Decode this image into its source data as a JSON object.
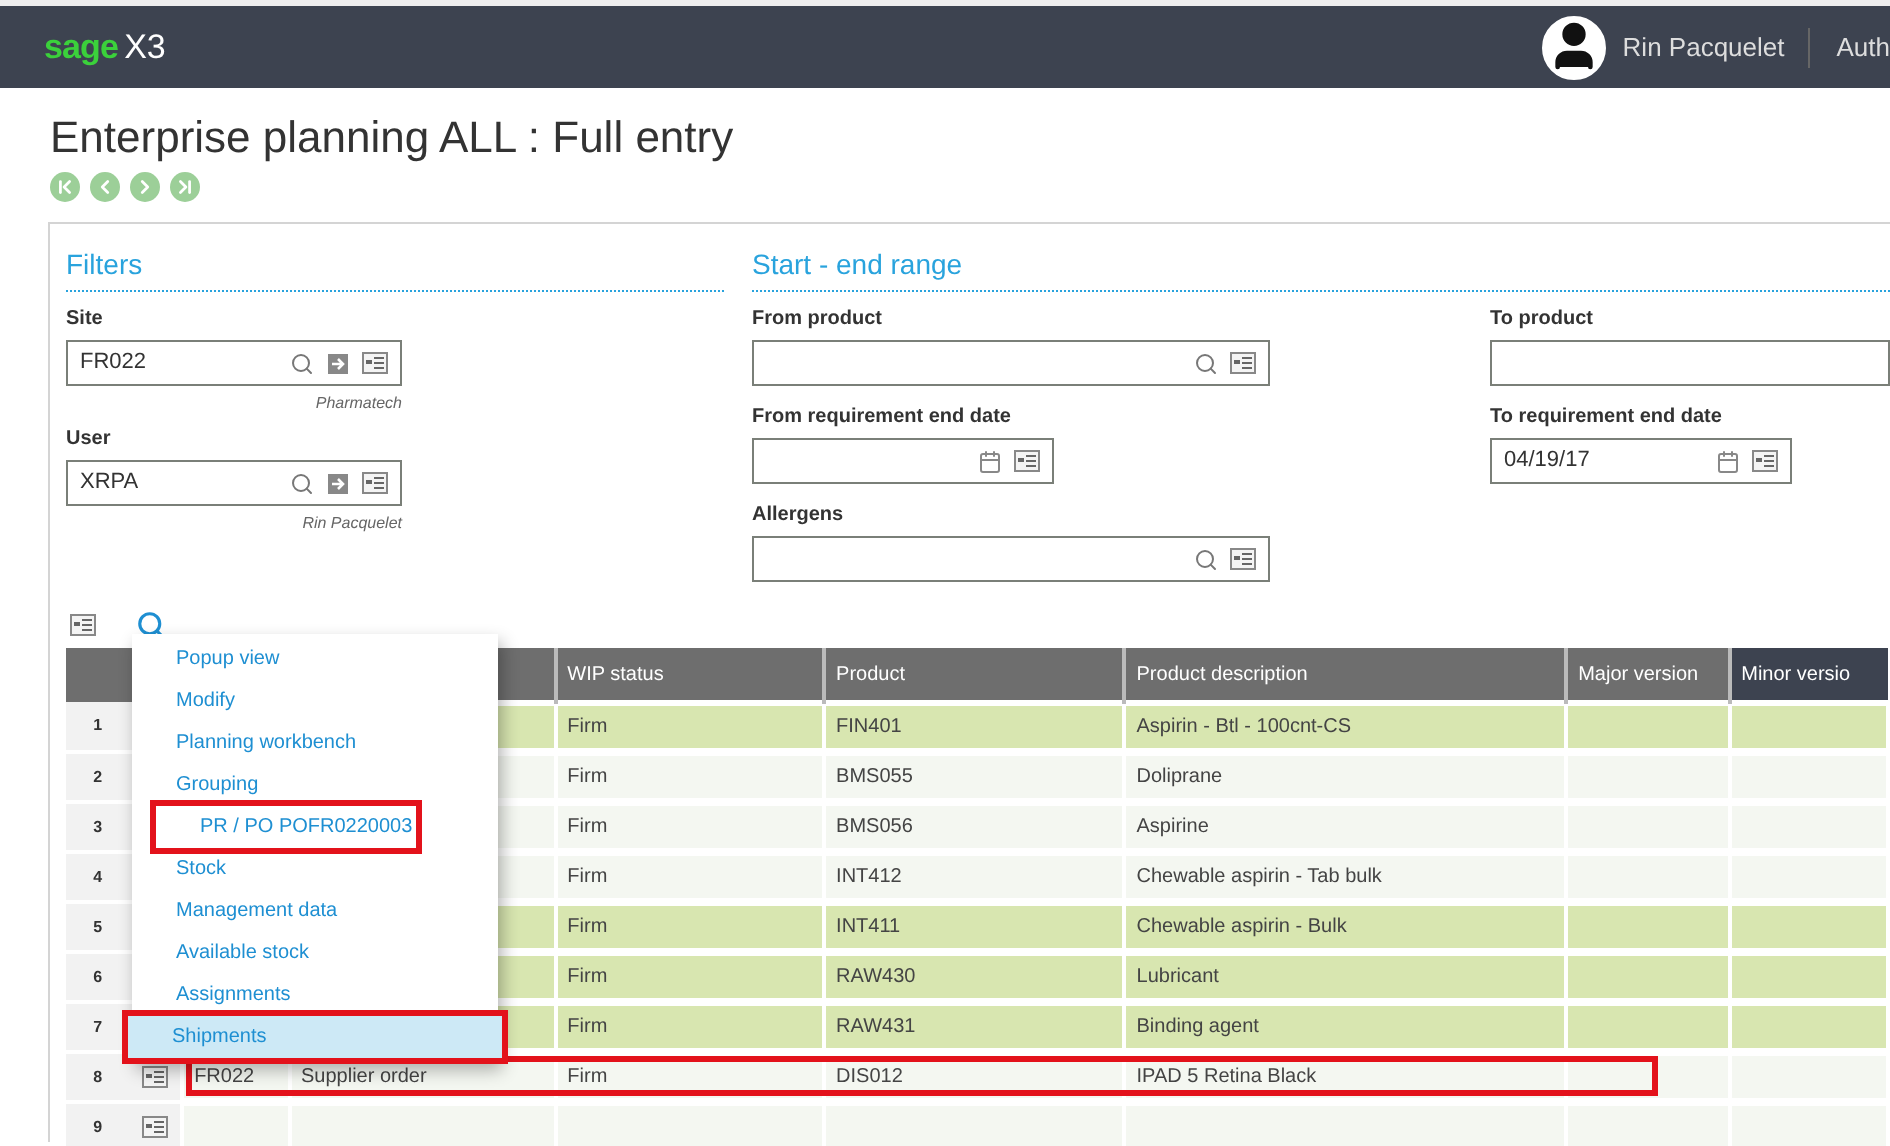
{
  "header": {
    "logo_brand": "sage",
    "logo_product": "X3",
    "user": "Rin Pacquelet",
    "next_item": "Auth"
  },
  "title": "Enterprise planning ALL : Full entry",
  "filters": {
    "title": "Filters",
    "fields": [
      {
        "label": "Site",
        "value": "FR022",
        "caption": "Pharmatech"
      },
      {
        "label": "User",
        "value": "XRPA",
        "caption": "Rin Pacquelet"
      }
    ]
  },
  "range": {
    "title": "Start - end range",
    "fields": [
      {
        "label": "From product",
        "kind": "lookup"
      },
      {
        "label": "To product",
        "kind": "cut"
      },
      {
        "label": "From requirement end date",
        "kind": "date"
      },
      {
        "label": "To requirement end date",
        "value": "04/19/17",
        "kind": "date"
      },
      {
        "label": "Allergens",
        "kind": "lookup"
      }
    ]
  },
  "grid": {
    "columns": [
      "WIP status",
      "Product",
      "Product description",
      "Major version",
      "Minor versio"
    ],
    "rows": [
      {
        "number": "1",
        "highlighted": true,
        "annotated": false,
        "wip": "Firm",
        "product": "FIN401",
        "description": "Aspirin - Btl - 100cnt-CS"
      },
      {
        "number": "2",
        "highlighted": false,
        "annotated": false,
        "wip": "Firm",
        "product": "BMS055",
        "description": "Doliprane"
      },
      {
        "number": "3",
        "highlighted": false,
        "annotated": false,
        "wip": "Firm",
        "product": "BMS056",
        "description": "Aspirine"
      },
      {
        "number": "4",
        "highlighted": false,
        "annotated": false,
        "wip": "Firm",
        "product": "INT412",
        "description": "Chewable aspirin - Tab bulk"
      },
      {
        "number": "5",
        "highlighted": true,
        "annotated": false,
        "wip": "Firm",
        "product": "INT411",
        "description": "Chewable aspirin - Bulk"
      },
      {
        "number": "6",
        "highlighted": true,
        "annotated": false,
        "wip": "Firm",
        "product": "RAW430",
        "description": "Lubricant"
      },
      {
        "number": "7",
        "highlighted": true,
        "annotated": false,
        "wip": "Firm",
        "product": "RAW431",
        "description": "Binding agent"
      },
      {
        "number": "8",
        "highlighted": false,
        "annotated": true,
        "site": "FR022",
        "type": "Supplier order",
        "wip": "Firm",
        "product": "DIS012",
        "description": "IPAD 5 Retina Black"
      },
      {
        "number": "9",
        "highlighted": false,
        "annotated": false
      }
    ]
  },
  "menu": {
    "items": [
      {
        "label": "Popup view",
        "selected": false,
        "annotated": false
      },
      {
        "label": "Modify",
        "selected": false,
        "annotated": false
      },
      {
        "label": "Planning workbench",
        "selected": false,
        "annotated": false
      },
      {
        "label": "Grouping",
        "selected": false,
        "annotated": false
      },
      {
        "label": "PR / PO POFR0220003",
        "selected": false,
        "annotated": true
      },
      {
        "label": "Stock",
        "selected": false,
        "annotated": false
      },
      {
        "label": "Management data",
        "selected": false,
        "annotated": false
      },
      {
        "label": "Available stock",
        "selected": false,
        "annotated": false
      },
      {
        "label": "Assignments",
        "selected": false,
        "annotated": false
      },
      {
        "label": "Shipments",
        "selected": true,
        "annotated": true
      }
    ]
  }
}
